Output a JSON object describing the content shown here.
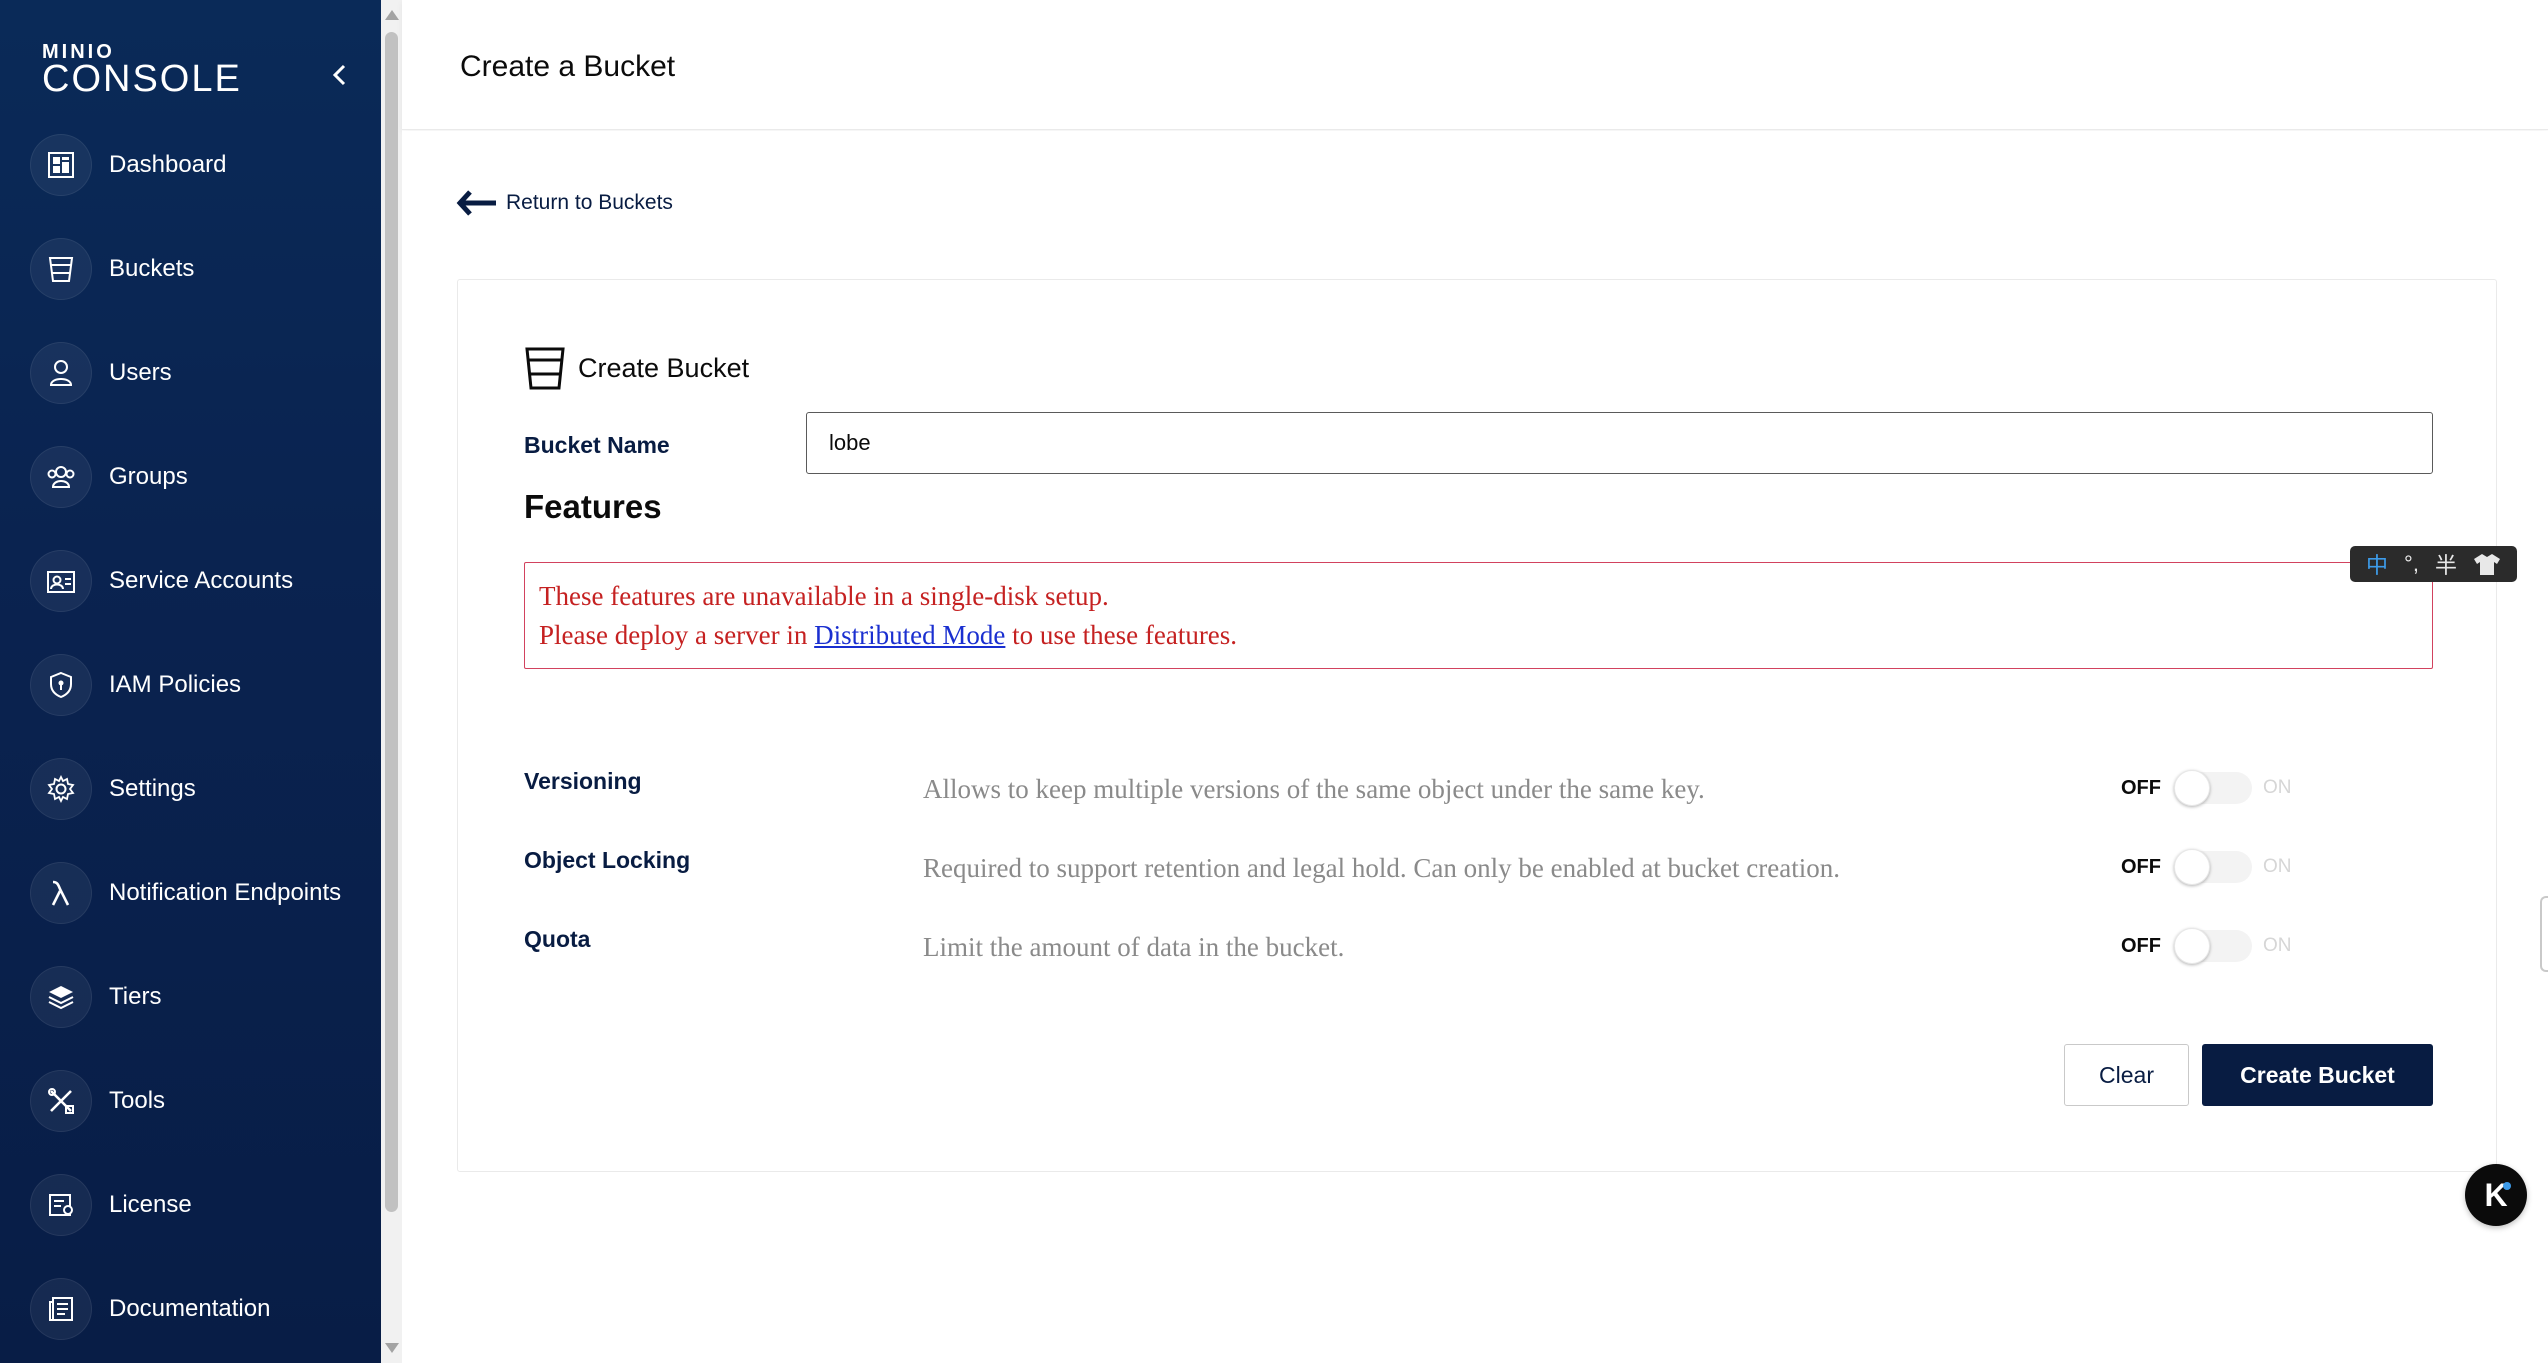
{
  "sidebar": {
    "logo_small": "MINIO",
    "logo_big": "CONSOLE",
    "items": [
      {
        "label": "Dashboard",
        "icon": "dashboard-icon"
      },
      {
        "label": "Buckets",
        "icon": "bucket-icon"
      },
      {
        "label": "Users",
        "icon": "user-icon"
      },
      {
        "label": "Groups",
        "icon": "groups-icon"
      },
      {
        "label": "Service Accounts",
        "icon": "service-accounts-icon"
      },
      {
        "label": "IAM Policies",
        "icon": "shield-icon"
      },
      {
        "label": "Settings",
        "icon": "gear-icon"
      },
      {
        "label": "Notification Endpoints",
        "icon": "lambda-icon"
      },
      {
        "label": "Tiers",
        "icon": "layers-icon"
      },
      {
        "label": "Tools",
        "icon": "tools-icon"
      },
      {
        "label": "License",
        "icon": "license-icon"
      },
      {
        "label": "Documentation",
        "icon": "documentation-icon"
      }
    ]
  },
  "header": {
    "title": "Create a Bucket"
  },
  "main": {
    "back_label": "Return to Buckets",
    "card_title": "Create Bucket",
    "bucket_name_label": "Bucket Name",
    "bucket_name_value": "lobe",
    "features_title": "Features",
    "alert": {
      "line1": "These features are unavailable in a single-disk setup.",
      "line2_prefix": "Please deploy a server in ",
      "line2_link": "Distributed Mode",
      "line2_suffix": " to use these features."
    },
    "features": [
      {
        "name": "Versioning",
        "description": "Allows to keep multiple versions of the same object under the same key.",
        "off_label": "OFF",
        "on_label": "ON",
        "enabled": false
      },
      {
        "name": "Object Locking",
        "description": "Required to support retention and legal hold. Can only be enabled at bucket creation.",
        "off_label": "OFF",
        "on_label": "ON",
        "enabled": false
      },
      {
        "name": "Quota",
        "description": "Limit the amount of data in the bucket.",
        "off_label": "OFF",
        "on_label": "ON",
        "enabled": false
      }
    ],
    "clear_label": "Clear",
    "create_label": "Create Bucket"
  },
  "ime": {
    "mode": "中",
    "punct": "°,",
    "width": "半"
  },
  "help_button_label": "K",
  "colors": {
    "sidebar": "#0a2a58",
    "primary": "#081c42",
    "alert": "#c52121",
    "link": "#1a2fd0"
  }
}
